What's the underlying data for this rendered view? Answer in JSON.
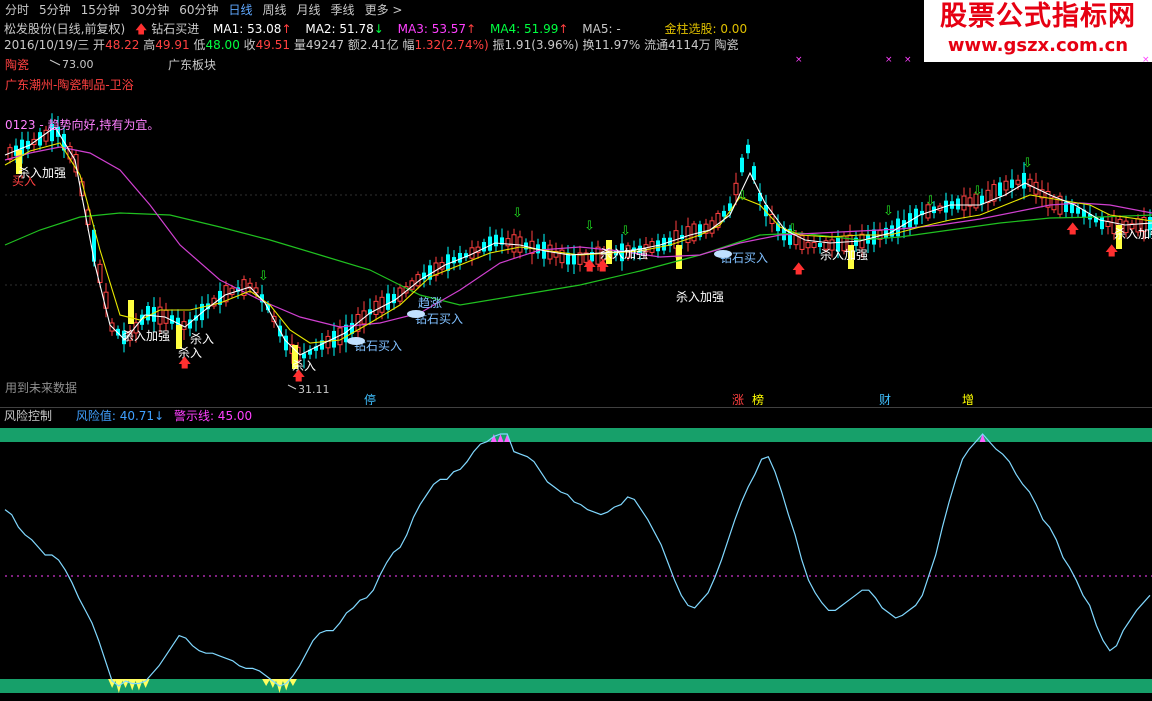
{
  "nav": {
    "tabs": [
      "分时",
      "5分钟",
      "15分钟",
      "30分钟",
      "60分钟",
      "日线",
      "周线",
      "月线",
      "季线",
      "更多"
    ],
    "active_index": 5,
    "more_icon": "chevron-right-icon"
  },
  "info": {
    "stock_label": "松发股份(日线,前复权)",
    "signal_label": "钻石买进",
    "ma1": "MA1: 53.08",
    "ma2": "MA2: 51.78",
    "ma3": "MA3: 53.57",
    "ma4": "MA4: 51.99",
    "ma5": "MA5: -",
    "gold": "金柱选股: 0.00",
    "date": "2016/10/19/三",
    "open_label": "开",
    "open": "48.22",
    "high_label": "高",
    "high": "49.91",
    "low_label": "低",
    "low": "48.00",
    "close_label": "收",
    "close": "49.51",
    "volume": "量49247",
    "amount": "额2.41亿",
    "change_label": "幅",
    "change": "1.32(2.74%)",
    "amplitude": "振1.91(3.96%)",
    "turnover": "换11.97%",
    "float": "流通4114万",
    "sector": "陶瓷"
  },
  "chart_tags": {
    "sector_tag": "陶瓷",
    "region_tag": "广东板块",
    "industry_line": "广东潮州-陶瓷制品-卫浴",
    "note": "0123 - 趋势向好,持有为宜。",
    "future_note": "用到未来数据",
    "max_label": "73.00",
    "min_label": "31.11"
  },
  "signals": {
    "buy": "买入",
    "add": "杀入加强",
    "kill": "杀入",
    "diamond": "钻石买入",
    "rise": "趋涨"
  },
  "events": [
    "停",
    "涨",
    "榜",
    "财",
    "增"
  ],
  "risk": {
    "title": "风险控制",
    "value_label": "风险值: 40.71",
    "warn_label": "警示线: 45.00",
    "values": [
      70,
      68,
      63,
      60,
      58,
      55,
      52,
      52,
      50,
      46,
      41,
      35,
      30,
      25,
      18,
      10,
      2,
      0,
      2,
      1,
      1,
      2,
      5,
      8,
      12,
      16,
      20,
      19,
      16,
      14,
      13,
      13,
      12,
      11,
      10,
      8,
      7,
      7,
      6,
      4,
      2,
      0,
      1,
      4,
      8,
      13,
      18,
      21,
      22,
      22,
      25,
      29,
      31,
      34,
      35,
      38,
      44,
      49,
      53,
      55,
      60,
      67,
      72,
      76,
      80,
      82,
      82,
      85,
      86,
      89,
      93,
      96,
      97,
      99,
      100,
      100,
      93,
      92,
      91,
      89,
      85,
      81,
      79,
      77,
      76,
      73,
      72,
      70,
      69,
      68,
      69,
      71,
      72,
      75,
      74,
      70,
      66,
      61,
      56,
      49,
      42,
      36,
      32,
      31,
      34,
      37,
      43,
      50,
      58,
      66,
      73,
      79,
      84,
      90,
      91,
      85,
      77,
      68,
      60,
      50,
      42,
      37,
      33,
      30,
      30,
      32,
      34,
      36,
      38,
      38,
      35,
      31,
      29,
      27,
      28,
      30,
      32,
      36,
      44,
      52,
      63,
      73,
      82,
      90,
      94,
      97,
      100,
      97,
      94,
      92,
      89,
      84,
      80,
      77,
      72,
      66,
      63,
      58,
      51,
      47,
      42,
      36,
      32,
      24,
      18,
      14,
      16,
      22,
      26,
      30,
      33,
      36
    ]
  },
  "colors": {
    "up": "#ff4040",
    "down": "#00ffff",
    "ma1": "#ffffff",
    "ma2": "#ffff00",
    "ma3": "#ff40ff",
    "ma4": "#00ff00",
    "risk_line": "#80d8ff",
    "band": "#17a06a",
    "warn": "#ff40ff",
    "watermark": "#e60012"
  },
  "watermark": {
    "title": "股票公式指标网",
    "url": "www.gszx.com.cn"
  }
}
